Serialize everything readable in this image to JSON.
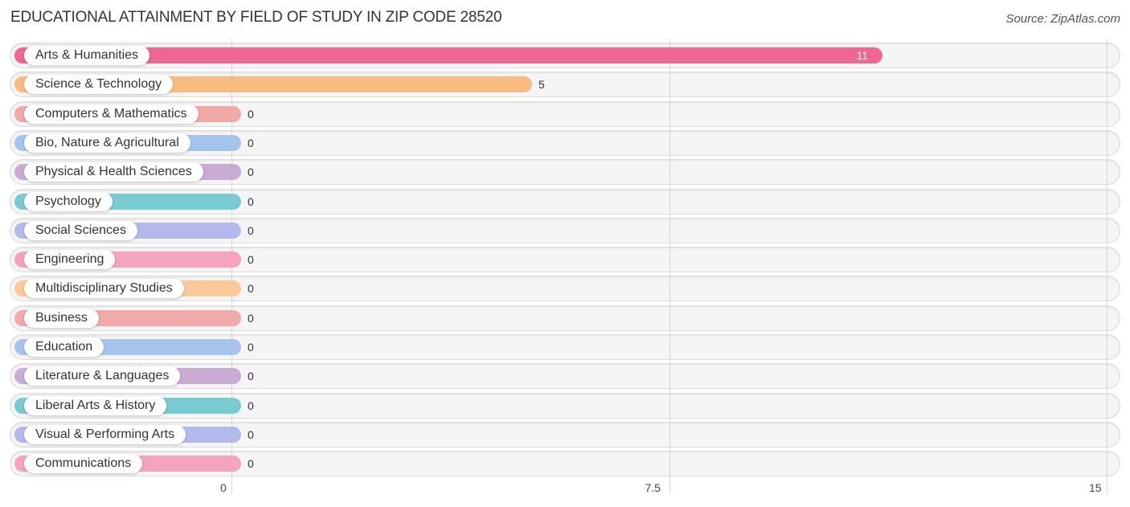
{
  "header": {
    "title": "EDUCATIONAL ATTAINMENT BY FIELD OF STUDY IN ZIP CODE 28520",
    "source": "Source: ZipAtlas.com"
  },
  "chart_data": {
    "type": "bar",
    "orientation": "horizontal",
    "title": "EDUCATIONAL ATTAINMENT BY FIELD OF STUDY IN ZIP CODE 28520",
    "source": "Source: ZipAtlas.com",
    "xlabel": "",
    "ylabel": "",
    "xlim": [
      0,
      15
    ],
    "ticks": [
      0,
      7.5,
      15
    ],
    "tick_labels": [
      "0",
      "7.5",
      "15"
    ],
    "grid": true,
    "legend": "none",
    "categories": [
      "Arts & Humanities",
      "Science & Technology",
      "Computers & Mathematics",
      "Bio, Nature & Agricultural",
      "Physical & Health Sciences",
      "Psychology",
      "Social Sciences",
      "Engineering",
      "Multidisciplinary Studies",
      "Business",
      "Education",
      "Literature & Languages",
      "Liberal Arts & History",
      "Visual & Performing Arts",
      "Communications"
    ],
    "values": [
      11,
      5,
      0,
      0,
      0,
      0,
      0,
      0,
      0,
      0,
      0,
      0,
      0,
      0,
      0
    ],
    "value_labels": [
      "11",
      "5",
      "0",
      "0",
      "0",
      "0",
      "0",
      "0",
      "0",
      "0",
      "0",
      "0",
      "0",
      "0",
      "0"
    ],
    "colors": [
      "#f06792",
      "#f9bb7f",
      "#f0a9a6",
      "#a7c5ec",
      "#c9acd3",
      "#78cbd0",
      "#b3baeb",
      "#f6a3bf",
      "#fbc999",
      "#f0aaaa",
      "#a7c5ec",
      "#c9acd3",
      "#78cbd0",
      "#b3baeb",
      "#f6a3bf"
    ]
  }
}
